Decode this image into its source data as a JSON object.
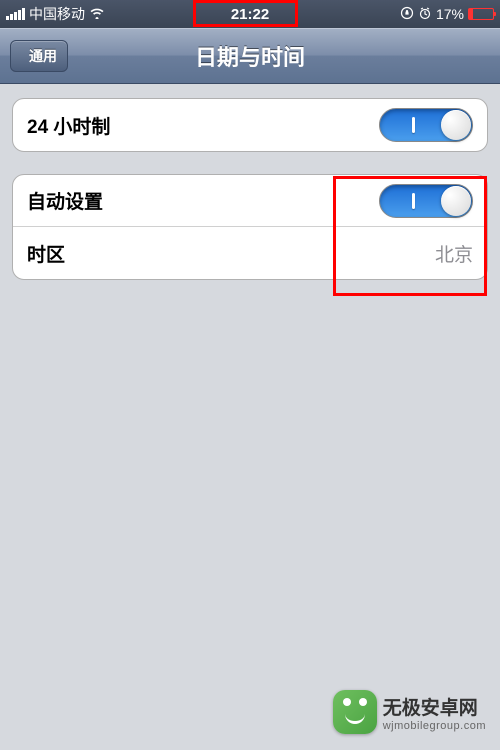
{
  "statusbar": {
    "carrier": "中国移动",
    "wifi_icon": "wifi-icon",
    "time": "21:22",
    "lock_icon": "orientation-lock-icon",
    "alarm_icon": "alarm-icon",
    "battery_percent": "17%"
  },
  "nav": {
    "back_label": "通用",
    "title": "日期与时间"
  },
  "group1": {
    "row1": {
      "label": "24 小时制",
      "toggle_on": true
    }
  },
  "group2": {
    "row1": {
      "label": "自动设置",
      "toggle_on": true
    },
    "row2": {
      "label": "时区",
      "value": "北京"
    }
  },
  "watermark": {
    "title": "无极安卓网",
    "url": "wjmobilegroup.com"
  },
  "colors": {
    "accent_blue": "#4a9eed",
    "highlight_red": "#ff0000",
    "battery_low": "#ff3333",
    "nav_gradient_top": "#a3b0c5",
    "nav_gradient_bottom": "#5d7291"
  }
}
